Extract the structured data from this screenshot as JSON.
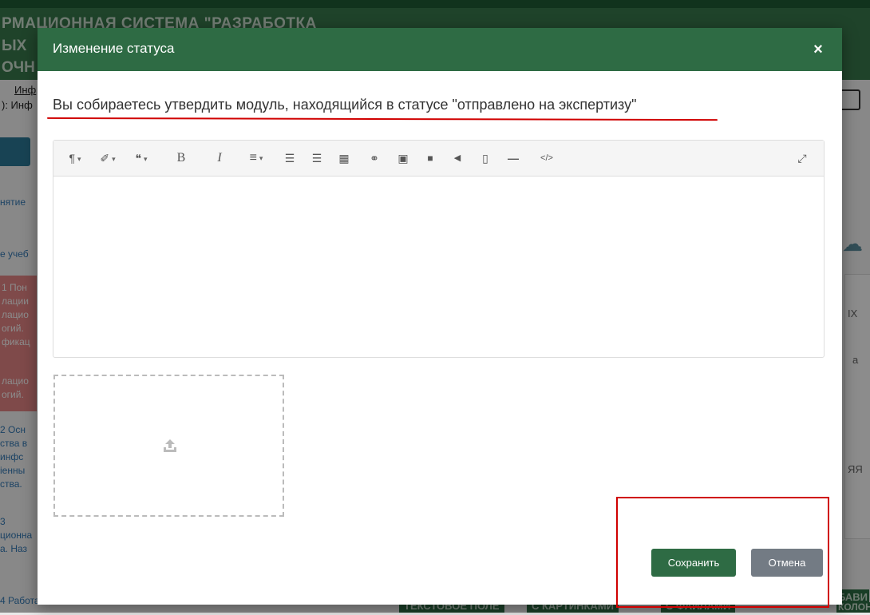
{
  "background": {
    "header_line1": "РМАЦИОННАЯ СИСТЕМА \"РАЗРАБОТКА",
    "header_line2": "ЫХ",
    "header_line3": "ОЧН",
    "crumb1": "Инф",
    "crumb2": "): Инф",
    "left_items": [
      "нятие",
      "е учеб"
    ],
    "red_items": [
      "1 Пон",
      "лации",
      "лацио",
      "огий.",
      "фикац",
      "",
      "лацио",
      "огий."
    ],
    "left_items2": [
      "2 Осн",
      "ства в",
      " инфс",
      "іенны",
      "ства.",
      "",
      "3",
      "ционна",
      "а. Наз"
    ],
    "left_bottom": "4 Работа в",
    "right_texts": [
      "IX",
      "а",
      "ЯЯ"
    ],
    "bottom_bar": [
      "ТЕКСТОВОЕ ПОЛЕ",
      "С КАРТИНКАМИ",
      "С ФАЙЛАМИ",
      "БАВИ",
      "КОЛОН"
    ]
  },
  "modal": {
    "title": "Изменение статуса",
    "close_label": "×",
    "message": "Вы собираетесь утвердить модуль, находящийся в статусе \"отправлено на экспертизу\"",
    "toolbar": {
      "paragraph": "¶",
      "magic": "✐",
      "quote": "❝",
      "bold": "B",
      "italic": "I",
      "align": "≡",
      "ordered_list": "☰",
      "unordered_list": "☰",
      "table": "▦",
      "link": "⚭",
      "image": "▣",
      "video": "■",
      "audio": "◀",
      "file": "▯",
      "hr": "—",
      "code": "</>",
      "fullscreen": "⤢"
    },
    "save_label": "Сохранить",
    "cancel_label": "Отмена"
  },
  "colors": {
    "accent": "#2e6b44",
    "cancel": "#737b84",
    "highlight": "#d00000"
  }
}
